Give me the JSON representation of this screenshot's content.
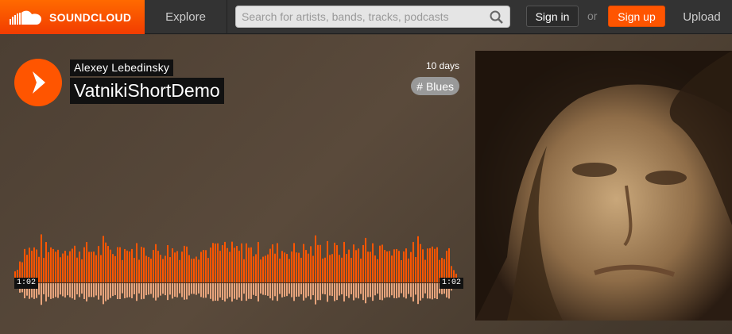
{
  "header": {
    "logo_text": "SOUNDCLOUD",
    "explore": "Explore",
    "search_placeholder": "Search for artists, bands, tracks, podcasts",
    "signin": "Sign in",
    "or": "or",
    "signup": "Sign up",
    "upload": "Upload"
  },
  "track": {
    "artist": "Alexey Lebedinsky",
    "title": "VatnikiShortDemo",
    "posted": "10 days",
    "tag": "# Blues",
    "time_left": "1:02",
    "time_right": "1:02"
  },
  "colors": {
    "brand": "#ff5500",
    "header_bg": "#333333",
    "wave_top": "#ff5500",
    "wave_bottom": "#e8a47c"
  },
  "icons": {
    "logo": "soundcloud-cloud-icon",
    "search": "search-icon",
    "play": "play-icon"
  }
}
